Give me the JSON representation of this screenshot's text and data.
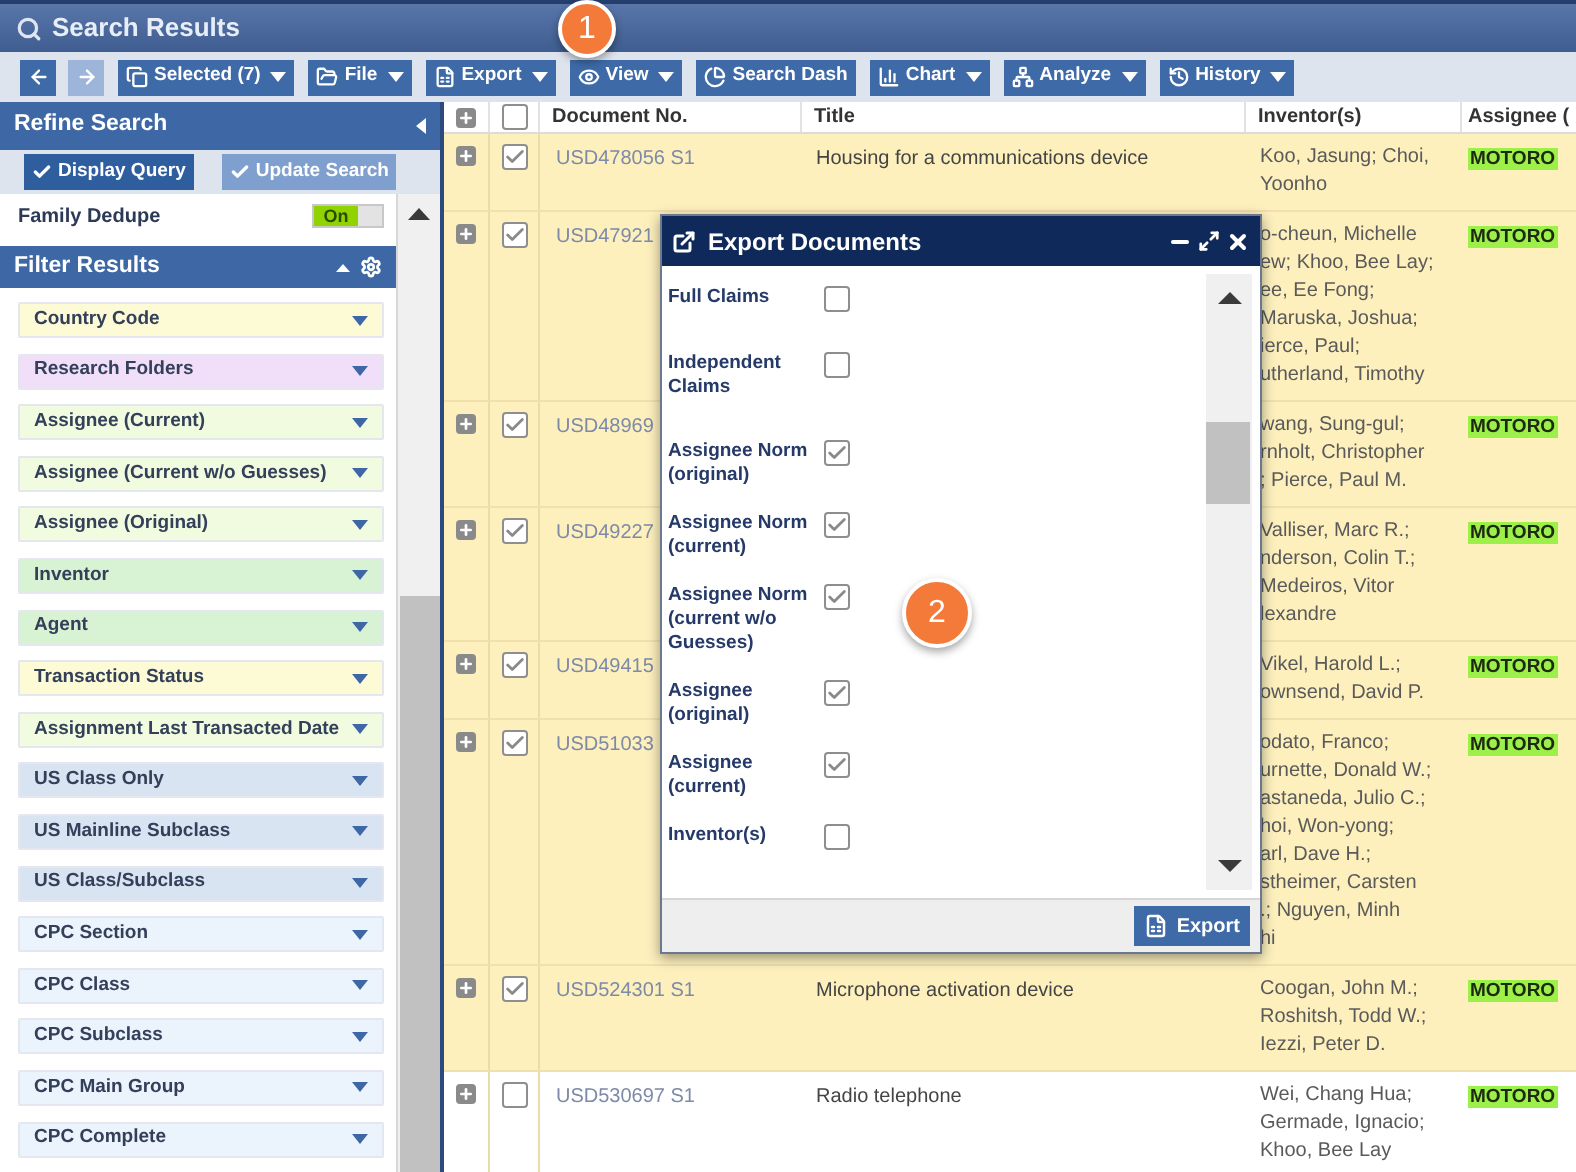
{
  "window": {
    "title": "Search Results"
  },
  "toolbar": [
    {
      "disabled": false
    },
    {
      "disabled": true
    },
    {
      "label": "Selected (7)",
      "dropdown": true
    },
    {
      "label": "File",
      "dropdown": true
    },
    {
      "label": "Export",
      "dropdown": true
    },
    {
      "label": "View",
      "dropdown": true
    },
    {
      "label": "Search Dash",
      "dropdown": false
    },
    {
      "label": "Chart",
      "dropdown": true
    },
    {
      "label": "Analyze",
      "dropdown": true
    },
    {
      "label": "History",
      "dropdown": true
    }
  ],
  "refine": {
    "title": "Refine Search",
    "buttons": [
      {
        "label": "Display Query",
        "disabled": false
      },
      {
        "label": "Update Search",
        "disabled": true
      }
    ],
    "toggles": [
      {
        "label": "Family Dedupe",
        "value": "On",
        "on": true
      }
    ]
  },
  "filters": {
    "title": "Filter Results",
    "items": [
      {
        "label": "Country Code",
        "color": "#fdfbd6"
      },
      {
        "label": "Research Folders",
        "color": "#f1def9"
      },
      {
        "label": "Assignee (Current)",
        "color": "#f1fbdf"
      },
      {
        "label": "Assignee (Current w/o Guesses)",
        "color": "#f1fbdf"
      },
      {
        "label": "Assignee (Original)",
        "color": "#f1fbdf"
      },
      {
        "label": "Inventor",
        "color": "#d8f3d3"
      },
      {
        "label": "Agent",
        "color": "#d8f3d3"
      },
      {
        "label": "Transaction Status",
        "color": "#fdfbd6"
      },
      {
        "label": "Assignment Last Transacted Date",
        "color": "#f1fbdf"
      },
      {
        "label": "US Class Only",
        "color": "#d9e4f2"
      },
      {
        "label": "US Mainline Subclass",
        "color": "#d9e4f2"
      },
      {
        "label": "US Class/Subclass",
        "color": "#d9e4f2"
      },
      {
        "label": "CPC Section",
        "color": "#ebf3fc"
      },
      {
        "label": "CPC Class",
        "color": "#ebf3fc"
      },
      {
        "label": "CPC Subclass",
        "color": "#ebf3fc"
      },
      {
        "label": "CPC Main Group",
        "color": "#ebf3fc"
      },
      {
        "label": "CPC Complete",
        "color": "#ebf3fc"
      }
    ]
  },
  "table": {
    "columns": [
      "Document No.",
      "Title",
      "Inventor(s)",
      "Assignee ("
    ],
    "header_checkbox": {
      "checked": false
    },
    "rows": [
      {
        "checked": true,
        "doc": "USD478056 S1",
        "title": "Housing for a communications device",
        "inventors": "Koo, Jasung; Choi,\nYoonho",
        "assignee": "MOTORO"
      },
      {
        "checked": true,
        "doc": "USD47921",
        "inventors": "o-cheun, Michelle\new; Khoo, Bee Lay;\nee, Ee Fong;\nMaruska, Joshua;\nierce, Paul;\nutherland, Timothy",
        "assignee": "MOTORO"
      },
      {
        "checked": true,
        "doc": "USD48969",
        "inventors": "wang, Sung-gul;\nrnholt, Christopher\n; Pierce, Paul M.",
        "assignee": "MOTORO"
      },
      {
        "checked": true,
        "doc": "USD49227",
        "inventors": "Valliser, Marc R.;\nnderson, Colin T.;\nMedeiros, Vitor\nlexandre",
        "assignee": "MOTORO"
      },
      {
        "checked": true,
        "doc": "USD49415",
        "inventors": "Vikel, Harold L.;\nownsend, David P.",
        "assignee": "MOTORO"
      },
      {
        "checked": true,
        "doc": "USD51033",
        "inventors": "odato, Franco;\nurnette, Donald W.;\nastaneda, Julio C.;\nhoi, Won-yong;\narl, Dave H.;\nstheimer, Carsten\n.; Nguyen, Minh\nhi",
        "assignee": "MOTORO"
      },
      {
        "checked": true,
        "doc": "USD524301 S1",
        "title": "Microphone activation device",
        "inventors": "Coogan, John M.;\nRoshitsh, Todd W.;\nIezzi, Peter D.",
        "assignee": "MOTORO"
      },
      {
        "checked": false,
        "doc": "USD530697 S1",
        "title": "Radio telephone",
        "inventors": "Wei, Chang Hua;\nGermade, Ignacio;\nKhoo, Bee Lay",
        "assignee": "MOTORO"
      }
    ]
  },
  "dialog": {
    "title": "Export Documents",
    "options": [
      {
        "label": "Full Claims",
        "checked": false
      },
      {
        "label": "Independent Claims",
        "checked": false
      },
      {
        "label": "Assignee Norm (original)",
        "checked": true
      },
      {
        "label": "Assignee Norm (current)",
        "checked": true
      },
      {
        "label": "Assignee Norm (current w/o Guesses)",
        "checked": true
      },
      {
        "label": "Assignee (original)",
        "checked": true
      },
      {
        "label": "Assignee (current)",
        "checked": true
      },
      {
        "label": "Inventor(s)",
        "checked": false
      }
    ],
    "button": "Export"
  },
  "callouts": [
    "1",
    "2"
  ]
}
